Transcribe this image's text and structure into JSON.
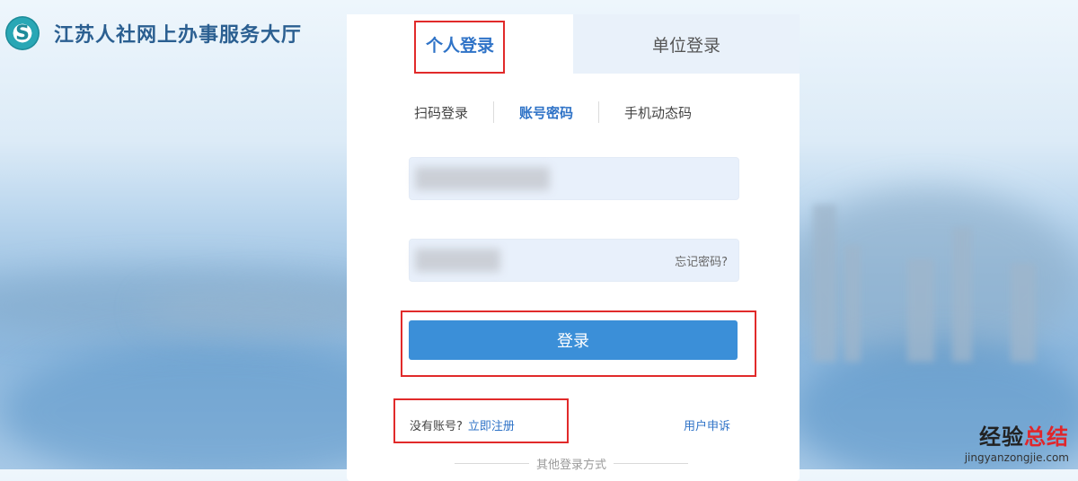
{
  "brand": {
    "logo_glyph": "S",
    "title": "江苏人社网上办事服务大厅"
  },
  "login": {
    "tabs": [
      {
        "label": "个人登录",
        "active": true
      },
      {
        "label": "单位登录",
        "active": false
      }
    ],
    "subtabs": [
      {
        "label": "扫码登录",
        "active": false
      },
      {
        "label": "账号密码",
        "active": true
      },
      {
        "label": "手机动态码",
        "active": false
      }
    ],
    "account_value": "",
    "password_value": "",
    "forgot_label": "忘记密码?",
    "login_button": "登录",
    "no_account_text": "没有账号?",
    "register_link": "立即注册",
    "appeal_link": "用户申诉",
    "other_methods": "其他登录方式"
  },
  "watermark": {
    "brand_plain": "经验",
    "brand_accent": "总结",
    "url": "jingyanzongjie.com"
  },
  "colors": {
    "accent": "#2f73c7",
    "button": "#3b8fd8",
    "highlight": "#e12a2a"
  }
}
